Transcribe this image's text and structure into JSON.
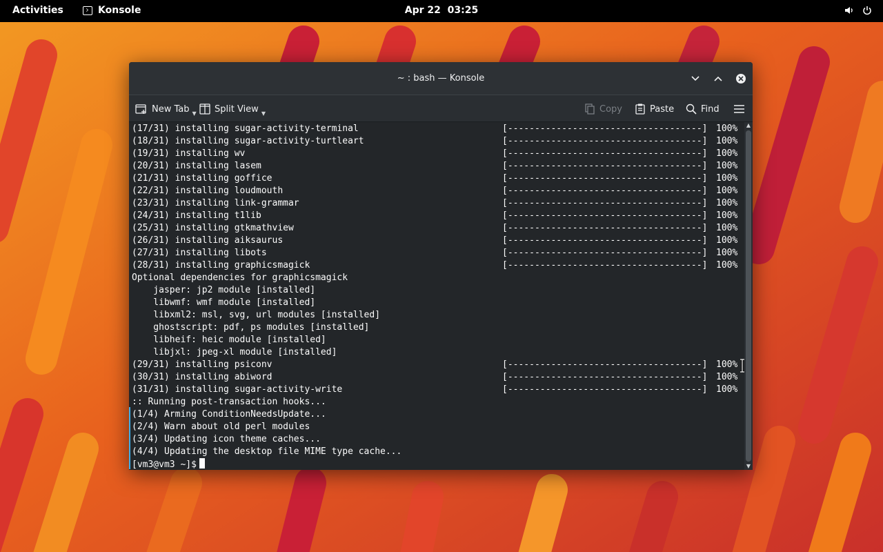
{
  "topbar": {
    "activities": "Activities",
    "app_name": "Konsole",
    "clock": "Apr 22  03:25",
    "icons": [
      "volume-icon",
      "power-icon"
    ]
  },
  "window": {
    "title": "~ : bash — Konsole",
    "controls": [
      "minimize-icon",
      "maximize-icon",
      "close-icon"
    ]
  },
  "toolbar": {
    "new_tab": "New Tab",
    "split_view": "Split View",
    "copy": "Copy",
    "paste": "Paste",
    "find": "Find",
    "icons": [
      "new-tab-icon",
      "split-view-icon",
      "copy-icon",
      "paste-icon",
      "search-icon",
      "hamburger-menu-icon"
    ]
  },
  "terminal": {
    "lines": [
      {
        "text": "(17/31) installing sugar-activity-terminal",
        "bar": "[------------------------------------]",
        "pct": "100%"
      },
      {
        "text": "(18/31) installing sugar-activity-turtleart",
        "bar": "[------------------------------------]",
        "pct": "100%"
      },
      {
        "text": "(19/31) installing wv",
        "bar": "[------------------------------------]",
        "pct": "100%"
      },
      {
        "text": "(20/31) installing lasem",
        "bar": "[------------------------------------]",
        "pct": "100%"
      },
      {
        "text": "(21/31) installing goffice",
        "bar": "[------------------------------------]",
        "pct": "100%"
      },
      {
        "text": "(22/31) installing loudmouth",
        "bar": "[------------------------------------]",
        "pct": "100%"
      },
      {
        "text": "(23/31) installing link-grammar",
        "bar": "[------------------------------------]",
        "pct": "100%"
      },
      {
        "text": "(24/31) installing t1lib",
        "bar": "[------------------------------------]",
        "pct": "100%"
      },
      {
        "text": "(25/31) installing gtkmathview",
        "bar": "[------------------------------------]",
        "pct": "100%"
      },
      {
        "text": "(26/31) installing aiksaurus",
        "bar": "[------------------------------------]",
        "pct": "100%"
      },
      {
        "text": "(27/31) installing libots",
        "bar": "[------------------------------------]",
        "pct": "100%"
      },
      {
        "text": "(28/31) installing graphicsmagick",
        "bar": "[------------------------------------]",
        "pct": "100%"
      },
      {
        "text": "Optional dependencies for graphicsmagick",
        "bar": "",
        "pct": ""
      },
      {
        "text": "    jasper: jp2 module [installed]",
        "bar": "",
        "pct": ""
      },
      {
        "text": "    libwmf: wmf module [installed]",
        "bar": "",
        "pct": ""
      },
      {
        "text": "    libxml2: msl, svg, url modules [installed]",
        "bar": "",
        "pct": ""
      },
      {
        "text": "    ghostscript: pdf, ps modules [installed]",
        "bar": "",
        "pct": ""
      },
      {
        "text": "    libheif: heic module [installed]",
        "bar": "",
        "pct": ""
      },
      {
        "text": "    libjxl: jpeg-xl module [installed]",
        "bar": "",
        "pct": ""
      },
      {
        "text": "(29/31) installing psiconv",
        "bar": "[------------------------------------]",
        "pct": "100%"
      },
      {
        "text": "(30/31) installing abiword",
        "bar": "[------------------------------------]",
        "pct": "100%"
      },
      {
        "text": "(31/31) installing sugar-activity-write",
        "bar": "[------------------------------------]",
        "pct": "100%"
      },
      {
        "text": ":: Running post-transaction hooks...",
        "bar": "",
        "pct": ""
      },
      {
        "text": "(1/4) Arming ConditionNeedsUpdate...",
        "bar": "",
        "pct": ""
      },
      {
        "text": "(2/4) Warn about old perl modules",
        "bar": "",
        "pct": ""
      },
      {
        "text": "(3/4) Updating icon theme caches...",
        "bar": "",
        "pct": ""
      },
      {
        "text": "(4/4) Updating the desktop file MIME type cache...",
        "bar": "",
        "pct": ""
      }
    ],
    "prompt": "[vm3@vm3 ~]$"
  },
  "colors": {
    "terminal_bg": "#232629",
    "titlebar_bg": "#2d3135",
    "accent": "#3daee9",
    "wallpaper_orange": "#f07a1a",
    "wallpaper_red": "#c8202f"
  }
}
